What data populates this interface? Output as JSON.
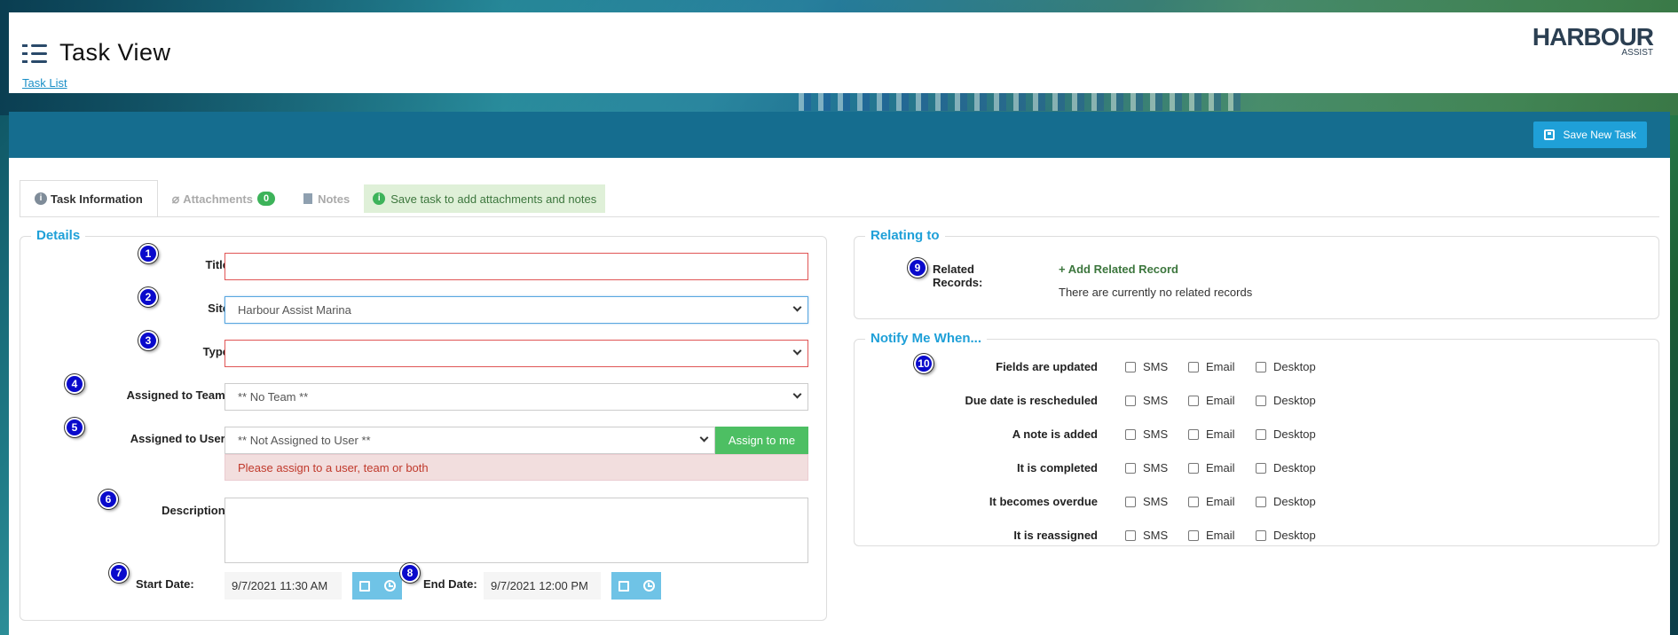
{
  "header": {
    "title": "Task View",
    "breadcrumb": "Task List",
    "logo_brand": "HARBOUR",
    "logo_sub": "ASSIST"
  },
  "toolbar": {
    "save_label": "Save New Task"
  },
  "tabs": [
    {
      "label": "Task Information",
      "active": true
    },
    {
      "label": "Attachments",
      "badge": "0"
    },
    {
      "label": "Notes"
    }
  ],
  "tab_note": "Save task to add attachments and notes",
  "details": {
    "legend": "Details",
    "title_label": "Title",
    "title_value": "",
    "site_label": "Site",
    "site_value": "Harbour Assist Marina",
    "type_label": "Type",
    "type_value": "",
    "team_label": "Assigned to Team:",
    "team_value": "** No Team **",
    "user_label": "Assigned to User:",
    "user_value": "** Not Assigned to User **",
    "assign_me": "Assign to me",
    "assign_error": "Please assign to a user, team or both",
    "description_label": "Description:",
    "start_label": "Start Date:",
    "start_value": "9/7/2021 11:30 AM",
    "end_label": "End Date:",
    "end_value": "9/7/2021 12:00 PM"
  },
  "relating": {
    "legend": "Relating to",
    "label": "Related Records:",
    "add": "+ Add Related Record",
    "none": "There are currently no related records"
  },
  "notify": {
    "legend": "Notify Me When...",
    "channels": [
      "SMS",
      "Email",
      "Desktop"
    ],
    "rows": [
      "Fields are updated",
      "Due date is rescheduled",
      "A note is added",
      "It is completed",
      "It becomes overdue",
      "It is reassigned"
    ]
  },
  "markers": [
    "1",
    "2",
    "3",
    "4",
    "5",
    "6",
    "7",
    "8",
    "9",
    "10"
  ],
  "colors": {
    "accent": "#1fa0d8",
    "bar": "#156d8f",
    "success": "#4dbf63",
    "error": "#e05555"
  }
}
